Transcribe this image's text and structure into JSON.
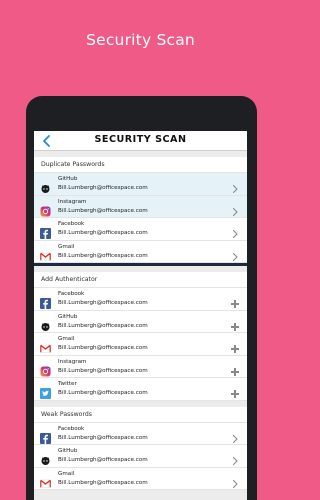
{
  "promo": {
    "title": "Security Scan"
  },
  "appbar": {
    "title": "SECURITY SCAN",
    "back_icon": "chevron-left-icon"
  },
  "colors": {
    "background": "#ef5a86",
    "accent": "#1e88e5",
    "highlight": "#e5f2f8"
  },
  "sections": [
    {
      "title": "Duplicate Passwords",
      "action_icon": "chevron-right-icon",
      "items": [
        {
          "service": "GitHub",
          "email": "Bill.Lumbergh@officespace.com",
          "icon": "github-icon",
          "highlighted": true
        },
        {
          "service": "Instagram",
          "email": "Bill.Lumbergh@officespace.com",
          "icon": "instagram-icon",
          "highlighted": true
        },
        {
          "service": "Facebook",
          "email": "Bill.Lumbergh@officespace.com",
          "icon": "facebook-icon",
          "highlighted": false
        },
        {
          "service": "Gmail",
          "email": "Bill.Lumbergh@officespace.com",
          "icon": "gmail-icon",
          "highlighted": false
        }
      ]
    },
    {
      "title": "Add Authenticator",
      "action_icon": "plus-icon",
      "items": [
        {
          "service": "Facebook",
          "email": "Bill.Lumbergh@officespace.com",
          "icon": "facebook-icon"
        },
        {
          "service": "GitHub",
          "email": "Bill.Lumbergh@officespace.com",
          "icon": "github-icon"
        },
        {
          "service": "Gmail",
          "email": "Bill.Lumbergh@officespace.com",
          "icon": "gmail-icon"
        },
        {
          "service": "Instagram",
          "email": "Bill.Lumbergh@officespace.com",
          "icon": "instagram-icon"
        },
        {
          "service": "Twitter",
          "email": "Bill.Lumbergh@officespace.com",
          "icon": "twitter-icon"
        }
      ]
    },
    {
      "title": "Weak Passwords",
      "action_icon": "chevron-right-icon",
      "items": [
        {
          "service": "Facebook",
          "email": "Bill.Lumbergh@officespace.com",
          "icon": "facebook-icon"
        },
        {
          "service": "GitHub",
          "email": "Bill.Lumbergh@officespace.com",
          "icon": "github-icon"
        },
        {
          "service": "Gmail",
          "email": "Bill.Lumbergh@officespace.com",
          "icon": "gmail-icon"
        }
      ]
    }
  ]
}
